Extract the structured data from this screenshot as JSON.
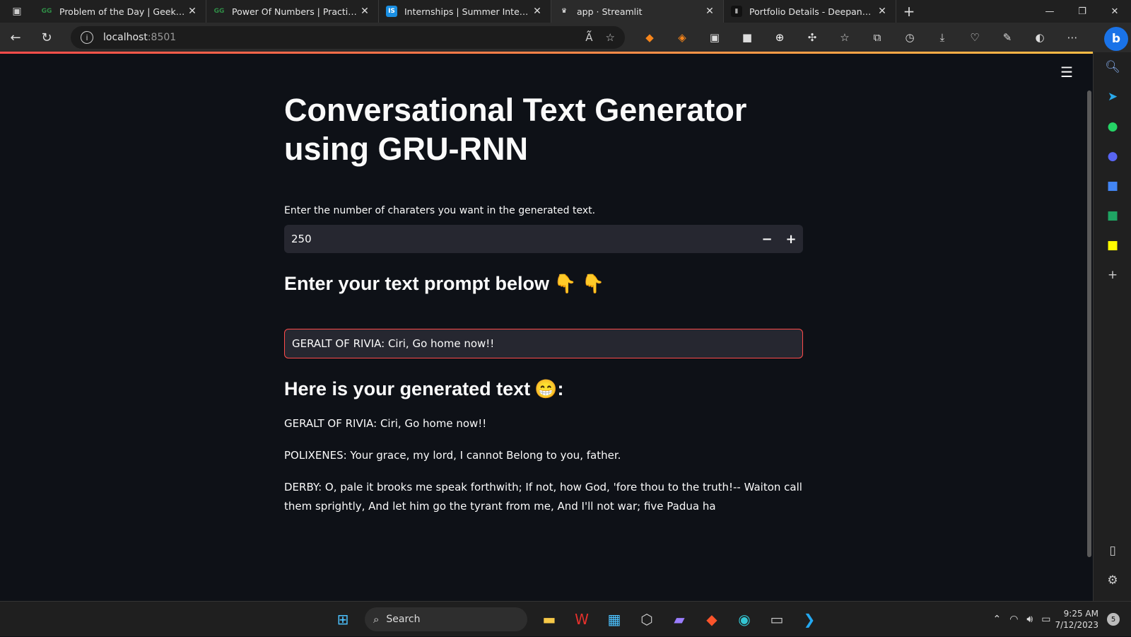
{
  "browser": {
    "tabs": [
      {
        "title": "Problem of the Day | GeeksforGe",
        "favicon": "gfg-icon",
        "fav_text": "GG",
        "fav_color": "#2f8d46",
        "active": false
      },
      {
        "title": "Power Of Numbers | Practice | Ge",
        "favicon": "gfg-icon",
        "fav_text": "GG",
        "fav_color": "#2f8d46",
        "active": false
      },
      {
        "title": "Internships | Summer Internship",
        "favicon": "internshala-icon",
        "fav_text": "IS",
        "fav_color": "#1a8fe3",
        "active": false
      },
      {
        "title": "app · Streamlit",
        "favicon": "streamlit-icon",
        "fav_text": "♛",
        "fav_color": "#2b2b2b",
        "active": true
      },
      {
        "title": "Portfolio Details - Deepankar Sha",
        "favicon": "portfolio-icon",
        "fav_text": "▮",
        "fav_color": "#111111",
        "active": false
      }
    ],
    "address": {
      "host": "localhost",
      "port": ":8501"
    }
  },
  "app": {
    "title": "Conversational Text Generator using GRU-RNN",
    "number_input": {
      "label": "Enter the number of charaters you want in the generated text.",
      "value": "250",
      "minus": "−",
      "plus": "+"
    },
    "prompt_heading": "Enter your text prompt below",
    "prompt_emoji": "👇 👇",
    "prompt_value": "GERALT OF RIVIA: Ciri, Go home now!!",
    "generated_heading": "Here is your generated text",
    "generated_emoji": "😁",
    "generated_colon": ":",
    "generated_paragraphs": [
      "GERALT OF RIVIA: Ciri, Go home now!!",
      "POLIXENES: Your grace, my lord, I cannot Belong to you, father.",
      "DERBY: O, pale it brooks me speak forthwith; If not, how God, 'fore thou to the truth!-- Waiton call them sprightly, And let him go the tyrant from me, And I'll not war; five Padua ha"
    ]
  },
  "taskbar": {
    "search_label": "Search",
    "time": "9:25 AM",
    "date": "7/12/2023",
    "notification_count": "5"
  },
  "colors": {
    "accent": "#ff4b4b",
    "background": "#0e1117",
    "input_bg": "#262730"
  }
}
